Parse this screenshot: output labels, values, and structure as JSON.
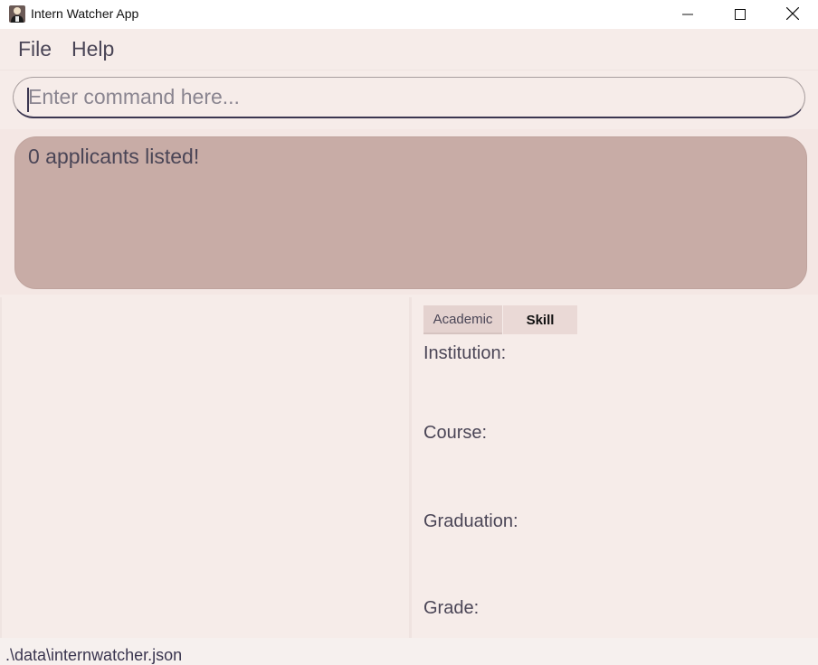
{
  "window": {
    "title": "Intern Watcher App"
  },
  "menu": {
    "file": "File",
    "help": "Help"
  },
  "command": {
    "placeholder": "Enter command here..."
  },
  "result": {
    "message": "0 applicants listed!"
  },
  "detail": {
    "tabs": [
      "Academic",
      "Skill"
    ],
    "active_tab": "Academic",
    "labels": {
      "institution": "Institution:",
      "course": "Course:",
      "graduation": "Graduation:",
      "grade": "Grade:"
    }
  },
  "status": {
    "file_path": ".\\data\\internwatcher.json"
  },
  "icons": {
    "app": "person-icon",
    "minimize": "minimize-icon",
    "maximize": "maximize-icon",
    "close": "close-icon"
  },
  "colors": {
    "background": "#f6ece9",
    "result_box": "#c8aca6",
    "text": "#4a4556",
    "accent": "#3b3650"
  }
}
